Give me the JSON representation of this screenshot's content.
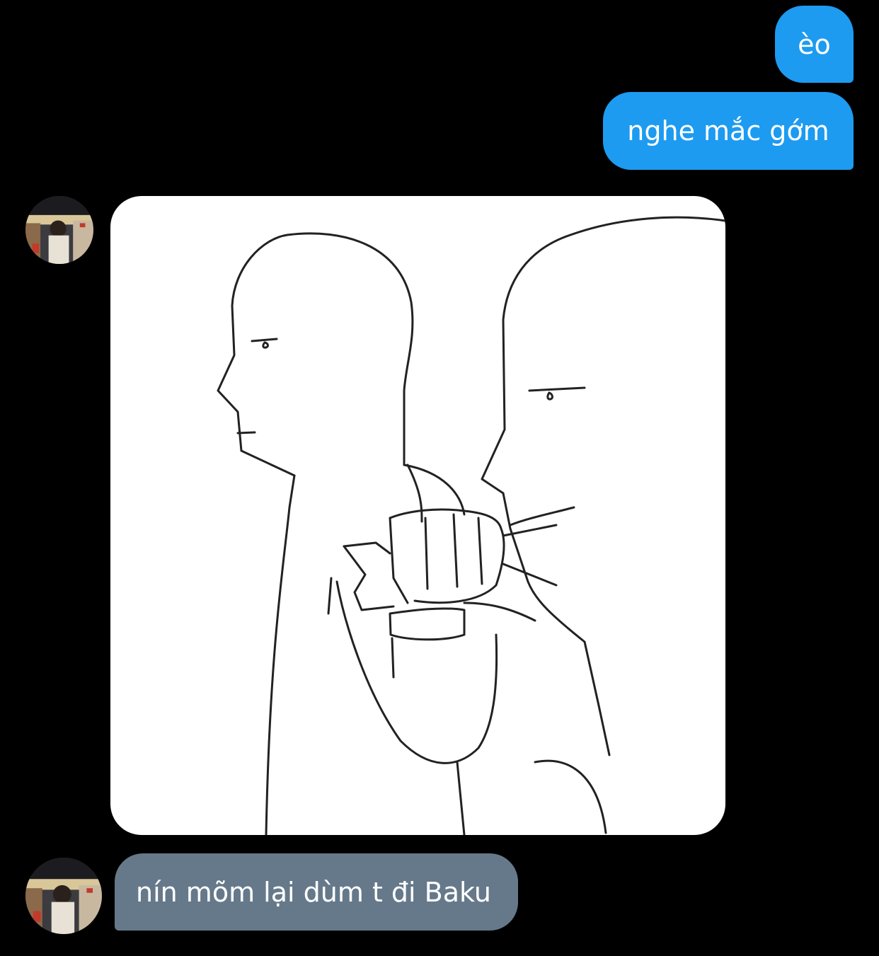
{
  "conversation": {
    "messages": [
      {
        "sender": "me",
        "type": "text",
        "text": "èo"
      },
      {
        "sender": "me",
        "type": "text",
        "text": "nghe mắc gớm"
      },
      {
        "sender": "other",
        "type": "image",
        "image_icon": "punch-meme-drawing-icon"
      },
      {
        "sender": "other",
        "type": "text",
        "text": "nín mõm lại dùm t đi Baku"
      }
    ]
  },
  "colors": {
    "background": "#000000",
    "outgoing_bubble": "#1d9bf0",
    "incoming_bubble": "#66798a",
    "text": "#ffffff"
  }
}
